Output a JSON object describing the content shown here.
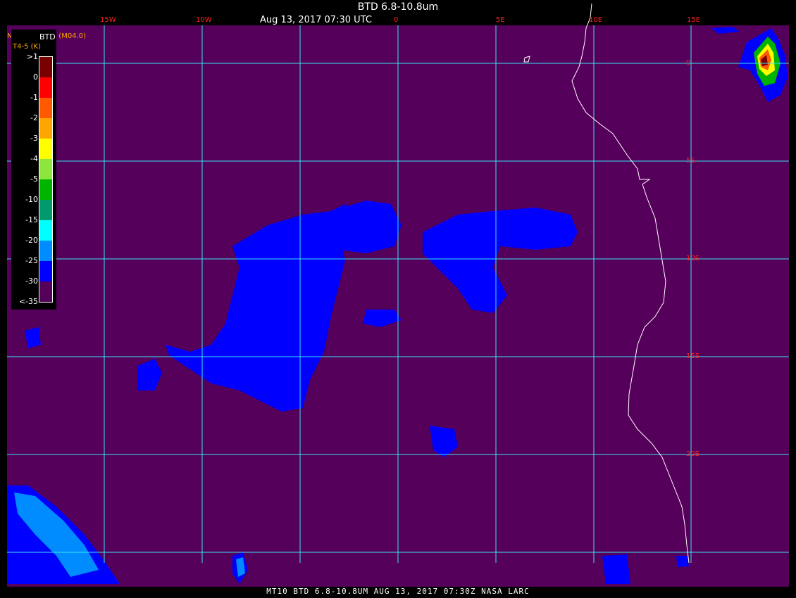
{
  "title": "BTD 6.8-10.8um",
  "subtitle": "Aug 13, 2017 07:30 UTC",
  "organization": "NASA Langley (M04.0)",
  "footer": "MT10  BTD 6.8-10.8UM   AUG 13, 2017 07:30Z   NASA LARC",
  "legend": {
    "title": "BTD",
    "subtitle": "T4-5 (K)",
    "labels": [
      ">1",
      "0",
      "-1",
      "-2",
      "-3",
      "-4",
      "-5",
      "-10",
      "-15",
      "-20",
      "-25",
      "-30",
      "<-35"
    ],
    "colors": [
      "#7a0000",
      "#ff0000",
      "#ff5a00",
      "#ffa500",
      "#ffff00",
      "#8ce63c",
      "#00b400",
      "#009a6e",
      "#00ffff",
      "#008cff",
      "#0000ff",
      "#55005a"
    ]
  },
  "grid": {
    "longitudes": [
      "15W",
      "10W",
      "0",
      "5E",
      "10E",
      "15E"
    ],
    "latitudes": [
      "0",
      "5S",
      "10S",
      "15S",
      "20S"
    ]
  },
  "colors": {
    "background": "#55005a",
    "gridline": "#38e5f5",
    "coastline": "#ffffff",
    "cloud": "#0000ff"
  }
}
